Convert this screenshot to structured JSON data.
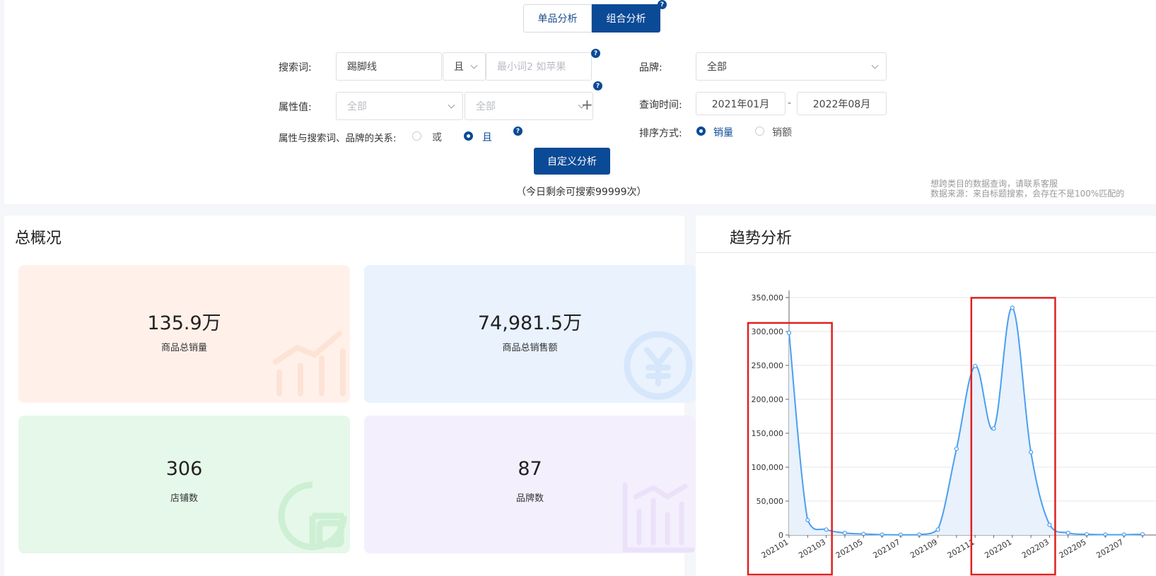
{
  "mode_toggle": {
    "single": "单品分析",
    "combo": "组合分析",
    "help": "?"
  },
  "form": {
    "keyword_label": "搜索词:",
    "keyword_value": "踢脚线",
    "logic_value": "且",
    "keyword2_placeholder": "最小词2 如苹果",
    "attr_label": "属性值:",
    "attr1_placeholder": "全部",
    "attr2_placeholder": "全部",
    "relation_label": "属性与搜索词、品牌的关系:",
    "relation_or": "或",
    "relation_and": "且",
    "brand_label": "品牌:",
    "brand_value": "全部",
    "time_label": "查询时间:",
    "time_start": "2021年01月",
    "time_sep": "-",
    "time_end": "2022年08月",
    "sort_label": "排序方式:",
    "sort_volume": "销量",
    "sort_amount": "销额",
    "submit_label": "自定义分析",
    "remaining_text": "（今日剩余可搜索99999次）",
    "note_line1": "想跨类目的数据查询，请联系客服",
    "note_line2": "数据来源：来自标题搜索，会存在不是100%匹配的"
  },
  "overview": {
    "title": "总概况",
    "cards": [
      {
        "value": "135.9万",
        "label": "商品总销量",
        "color": "#fff1ea"
      },
      {
        "value": "74,981.5万",
        "label": "商品总销售额",
        "color": "#e9f2fd"
      },
      {
        "value": "306",
        "label": "店铺数",
        "color": "#e6f8e9"
      },
      {
        "value": "87",
        "label": "品牌数",
        "color": "#f4effd"
      }
    ]
  },
  "trend": {
    "title": "趋势分析"
  },
  "chart_data": {
    "type": "area",
    "x": [
      "202101",
      "202102",
      "202103",
      "202104",
      "202105",
      "202106",
      "202107",
      "202108",
      "202109",
      "202110",
      "202111",
      "202112",
      "202201",
      "202202",
      "202203",
      "202204",
      "202205",
      "202206",
      "202207",
      "202208"
    ],
    "values": [
      298000,
      22000,
      8000,
      3000,
      1500,
      500,
      300,
      500,
      8000,
      127000,
      249000,
      157000,
      335000,
      122000,
      15000,
      3000,
      1000,
      500,
      500,
      1000
    ],
    "xtick_labels": [
      "202101",
      "202103",
      "202105",
      "202107",
      "202109",
      "202111",
      "202201",
      "202203",
      "202205",
      "202207"
    ],
    "yticks": [
      0,
      50000,
      100000,
      150000,
      200000,
      250000,
      300000,
      350000
    ],
    "ytick_labels": [
      "0",
      "50,000",
      "100,000",
      "150,000",
      "200,000",
      "250,000",
      "300,000",
      "350,000"
    ],
    "ylim": [
      0,
      350000
    ],
    "grid": true,
    "line_color": "#4a9ff0",
    "highlight_ranges": [
      [
        0,
        2
      ],
      [
        12,
        14
      ]
    ],
    "highlight_color": "#e02020"
  }
}
